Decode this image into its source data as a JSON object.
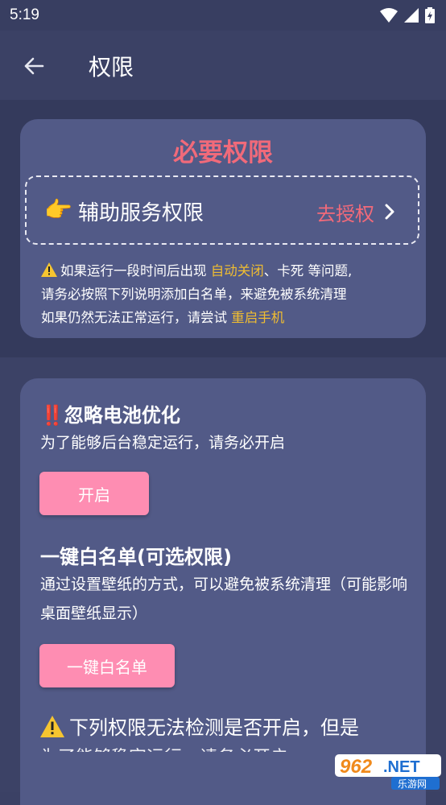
{
  "status": {
    "time": "5:19"
  },
  "appbar": {
    "title": "权限"
  },
  "required": {
    "title": "必要权限",
    "item_label": "辅助服务权限",
    "item_action": "去授权",
    "notice_line1_pre": "如果运行一段时间后出现 ",
    "notice_line1_hl": "自动关闭",
    "notice_line1_post": "、卡死 等问题,",
    "notice_line2": "请务必按照下列说明添加白名单，来避免被系统清理",
    "notice_line3_pre": "如果仍然无法正常运行，请尝试 ",
    "notice_line3_hl": "重启手机"
  },
  "battery": {
    "title": "‼️忽略电池优化",
    "desc": "为了能够后台稳定运行，请务必开启",
    "button": "开启"
  },
  "whitelist": {
    "title": "一键白名单(可选权限)",
    "desc": "通过设置壁纸的方式，可以避免被系统清理（可能影响桌面壁纸显示）",
    "button": "一键白名单"
  },
  "undetectable": {
    "title": "下列权限无法检测是否开启，但是",
    "partial": "为了能够稳定运行，请务必开启"
  },
  "watermark": {
    "number": "962",
    "suffix": ".NET",
    "sub": "乐游网"
  },
  "colors": {
    "accent_red": "#f16a7a",
    "highlight": "#f0bd31",
    "button_pink": "#fe8db2",
    "card": "#525a87"
  }
}
